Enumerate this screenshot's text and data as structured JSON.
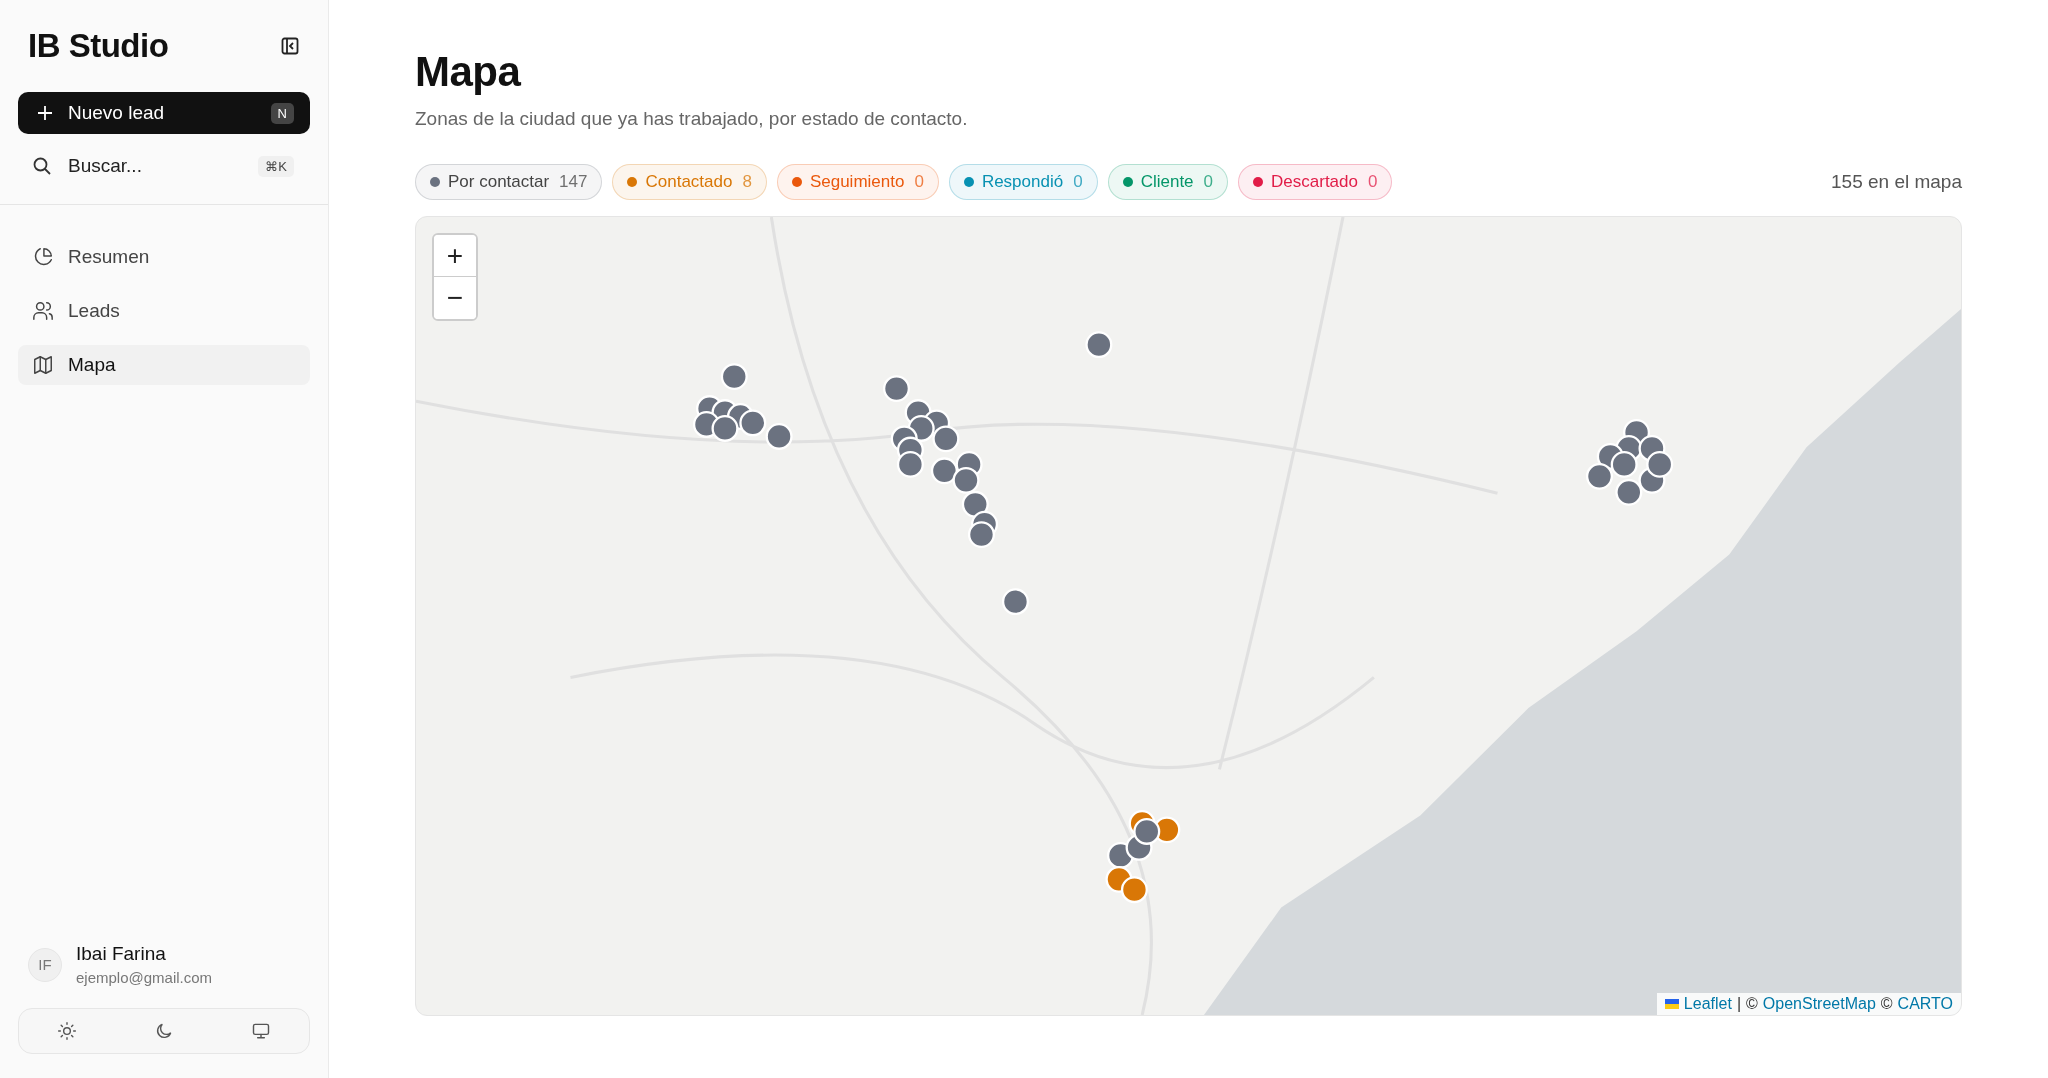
{
  "sidebar": {
    "brand": "IB Studio",
    "new_button": {
      "label": "Nuevo lead",
      "shortcut": "N"
    },
    "search": {
      "placeholder": "Buscar...",
      "shortcut": "⌘K"
    },
    "items": [
      {
        "label": "Resumen",
        "selected": false
      },
      {
        "label": "Leads",
        "selected": false
      },
      {
        "label": "Mapa",
        "selected": true
      }
    ],
    "user": {
      "initials": "IF",
      "name": "Ibai Farina",
      "email": "ejemplo@gmail.com"
    },
    "theme_options": [
      {
        "kind": "light"
      },
      {
        "kind": "dark"
      },
      {
        "kind": "system"
      }
    ]
  },
  "page": {
    "title": "Mapa",
    "subtitle": "Zonas de la ciudad que ya has trabajado, por estado de contacto.",
    "statuses": [
      {
        "label": "Por contactar",
        "count": "147",
        "color": "#6b7280"
      },
      {
        "label": "Contactado",
        "count": "8",
        "color": "#d97706"
      },
      {
        "label": "Seguimiento",
        "count": "0",
        "color": "#ea580c"
      },
      {
        "label": "Respondió",
        "count": "0",
        "color": "#0891b2"
      },
      {
        "label": "Cliente",
        "count": "0",
        "color": "#059669"
      },
      {
        "label": "Descartado",
        "count": "0",
        "color": "#e11d48"
      }
    ],
    "total": "155 en el mapa",
    "map": {
      "zoom_in": "+",
      "zoom_out": "−",
      "attribution": [
        {
          "text": "Leaflet",
          "kind": "link"
        },
        {
          "text": "|",
          "kind": "text"
        },
        {
          "text": "©",
          "kind": "text"
        },
        {
          "text": "OpenStreetMap",
          "kind": "link"
        },
        {
          "text": "©",
          "kind": "text"
        },
        {
          "text": "CARTO",
          "kind": "link"
        }
      ]
    }
  }
}
